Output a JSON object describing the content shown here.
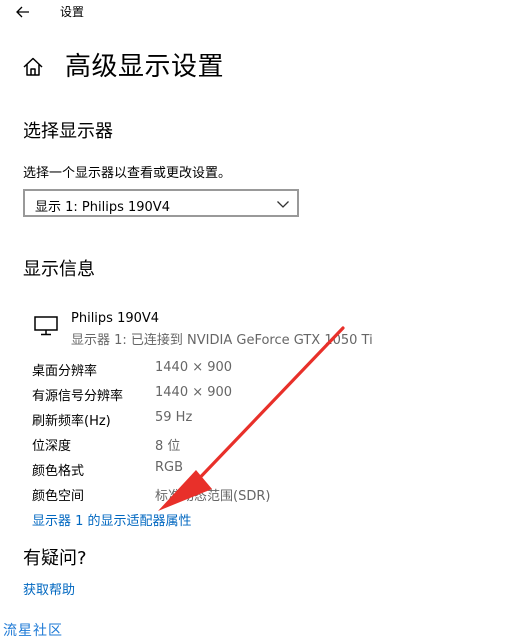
{
  "window": {
    "title": "设置"
  },
  "page": {
    "title": "高级显示设置"
  },
  "select_display": {
    "heading": "选择显示器",
    "description": "选择一个显示器以查看或更改设置。",
    "dropdown_value": "显示 1: Philips 190V4"
  },
  "display_info": {
    "heading": "显示信息",
    "monitor_name": "Philips 190V4",
    "connection": "显示器 1: 已连接到 NVIDIA GeForce GTX 1050 Ti",
    "rows": [
      {
        "label": "桌面分辨率",
        "value": "1440 × 900"
      },
      {
        "label": "有源信号分辨率",
        "value": "1440 × 900"
      },
      {
        "label": "刷新频率(Hz)",
        "value": "59 Hz"
      },
      {
        "label": "位深度",
        "value": "8 位"
      },
      {
        "label": "颜色格式",
        "value": "RGB"
      },
      {
        "label": "颜色空间",
        "value": "标准动态范围(SDR)"
      }
    ],
    "adapter_link": "显示器 1 的显示适配器属性"
  },
  "help": {
    "heading": "有疑问?",
    "link": "获取帮助"
  },
  "watermark": "流星社区",
  "colors": {
    "link": "#0067c0",
    "secondary_text": "#666666",
    "annotation_arrow": "#e8302a"
  },
  "icons": {
    "back": "back-arrow-icon",
    "home": "home-icon",
    "dropdown": "chevron-down-icon",
    "monitor": "monitor-icon"
  }
}
